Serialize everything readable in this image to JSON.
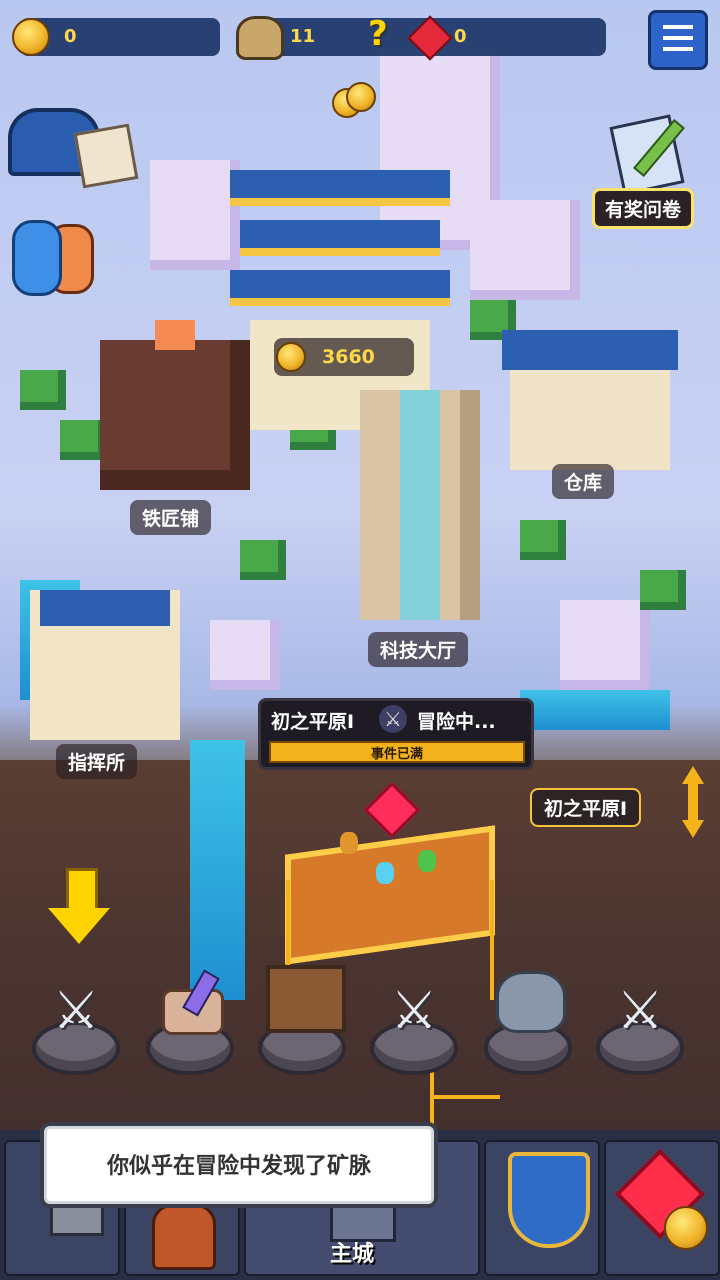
{
  "hud": {
    "coins": "0",
    "tokens": "11",
    "help": "?",
    "gems": "0"
  },
  "palace": {
    "coins": "3660"
  },
  "buildings": {
    "survey": "有奖问卷",
    "blacksmith": "铁匠铺",
    "warehouse": "仓库",
    "tech_hall": "科技大厅",
    "command_post": "指挥所"
  },
  "adventure": {
    "zone": "初之平原I",
    "status": "冒险中...",
    "event_bar": "事件已满"
  },
  "area_selector": "初之平原I",
  "toast": "你似乎在冒险中发现了矿脉",
  "bottom_nav": {
    "main_city": "主城"
  },
  "icons": [
    "coin-icon",
    "token-icon",
    "help-icon",
    "gem-icon",
    "menu-icon",
    "mailbox-icon",
    "friends-icon",
    "survey-icon",
    "swords-icon",
    "chest-icon",
    "rock-icon",
    "shield-icon"
  ],
  "colors": {
    "gold": "#ffd94a",
    "accent_blue": "#2e63c9",
    "ruby": "#ff2d5a"
  }
}
